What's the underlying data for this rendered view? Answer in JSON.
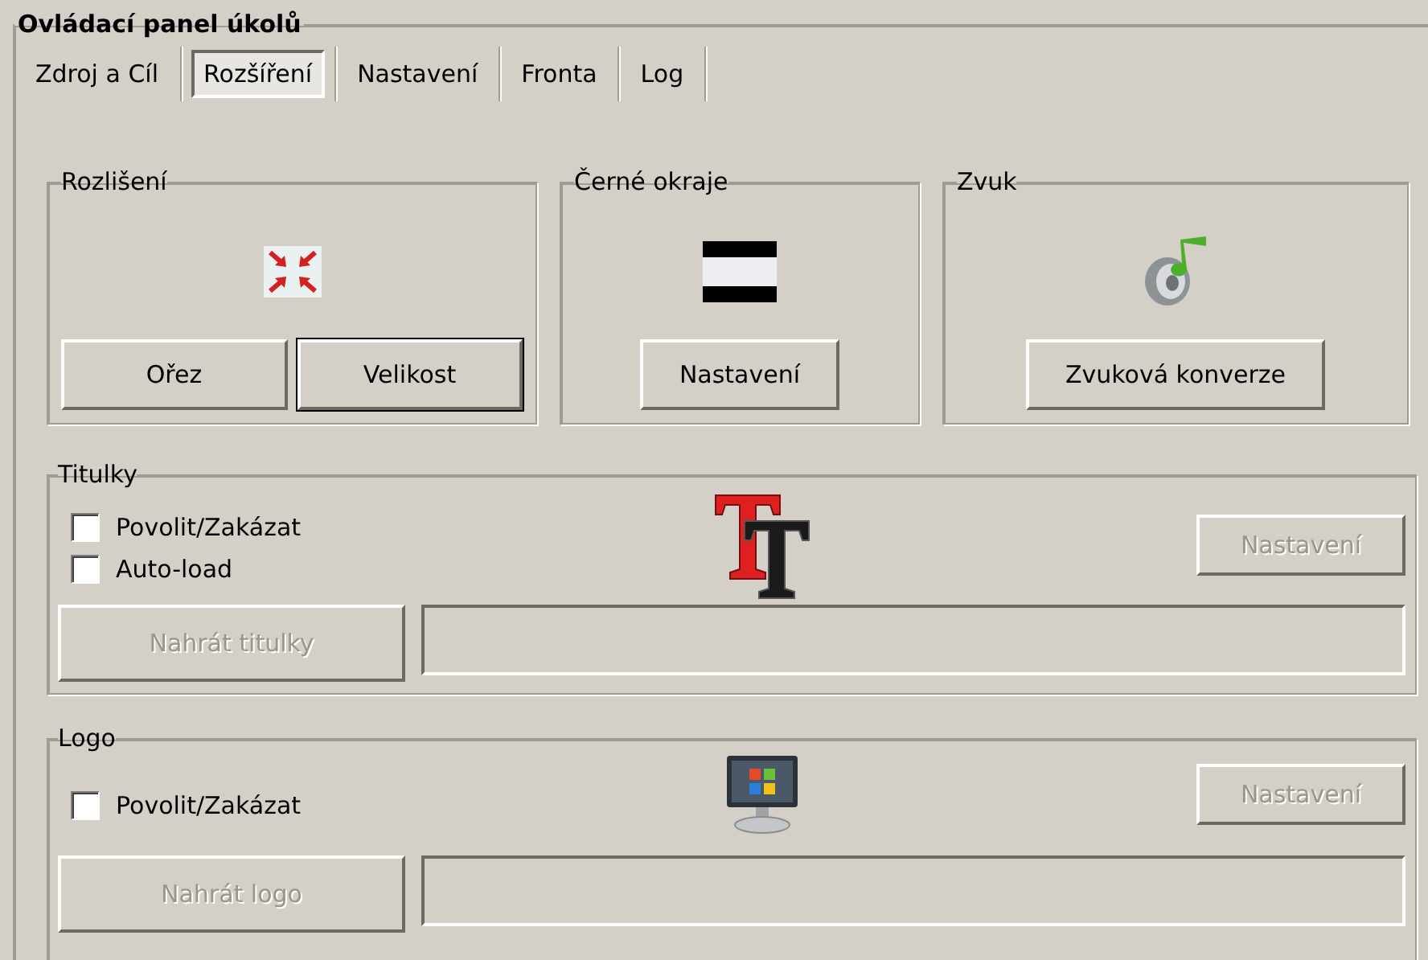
{
  "panel": {
    "title": "Ovládací panel úkolů"
  },
  "tabs": [
    {
      "label": "Zdroj a Cíl",
      "selected": false
    },
    {
      "label": "Rozšíření",
      "selected": true
    },
    {
      "label": "Nastavení",
      "selected": false
    },
    {
      "label": "Fronta",
      "selected": false
    },
    {
      "label": "Log",
      "selected": false
    }
  ],
  "groups": [
    {
      "title": "Rozlišení",
      "buttons": [
        {
          "label": "Ořez",
          "focused": false
        },
        {
          "label": "Velikost",
          "focused": true
        }
      ]
    },
    {
      "title": "Černé okraje",
      "buttons": [
        {
          "label": "Nastavení",
          "focused": false
        }
      ]
    },
    {
      "title": "Zvuk",
      "buttons": [
        {
          "label": "Zvuková konverze",
          "focused": false
        }
      ]
    }
  ],
  "subtitles": {
    "title": "Titulky",
    "checkboxes": [
      {
        "label": "Povolit/Zakázat",
        "checked": false
      },
      {
        "label": "Auto-load",
        "checked": false
      }
    ],
    "settings_button": {
      "label": "Nastavení",
      "disabled": true
    },
    "load_button": {
      "label": "Nahrát titulky",
      "disabled": true
    }
  },
  "logo": {
    "title": "Logo",
    "checkboxes": [
      {
        "label": "Povolit/Zakázat",
        "checked": false
      }
    ],
    "settings_button": {
      "label": "Nastavení",
      "disabled": true
    },
    "load_button": {
      "label": "Nahrát logo",
      "disabled": true
    }
  }
}
